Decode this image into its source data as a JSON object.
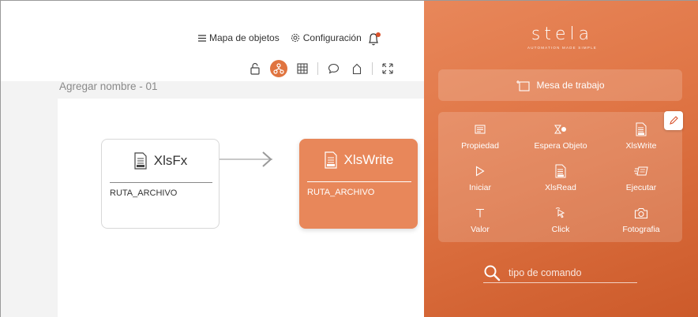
{
  "topnav": {
    "map_label": "Mapa de objetos",
    "config_label": "Configuración"
  },
  "workspace": {
    "title": "Agregar nombre - 01"
  },
  "nodes": [
    {
      "title": "XlsFx",
      "param": "RUTA_ARCHIVO"
    },
    {
      "title": "XlsWrite",
      "param": "RUTA_ARCHIVO"
    }
  ],
  "panel": {
    "logo": "stela",
    "tagline": "AUTOMATION MADE SIMPLE",
    "mesa_label": "Mesa de trabajo",
    "commands": [
      {
        "label": "Propiedad",
        "icon": "properties-icon"
      },
      {
        "label": "Espera Objeto",
        "icon": "hourglass-icon"
      },
      {
        "label": "XlsWrite",
        "icon": "xls-file-icon"
      },
      {
        "label": "Iniciar",
        "icon": "play-icon"
      },
      {
        "label": "XlsRead",
        "icon": "xls-file-icon"
      },
      {
        "label": "Ejecutar",
        "icon": "execute-icon"
      },
      {
        "label": "Valor",
        "icon": "text-icon"
      },
      {
        "label": "Click",
        "icon": "pointer-icon"
      },
      {
        "label": "Fotografia",
        "icon": "camera-icon"
      }
    ],
    "search_placeholder": "tipo de comando"
  },
  "colors": {
    "accent": "#e0743f",
    "node_active": "#e8875a"
  }
}
